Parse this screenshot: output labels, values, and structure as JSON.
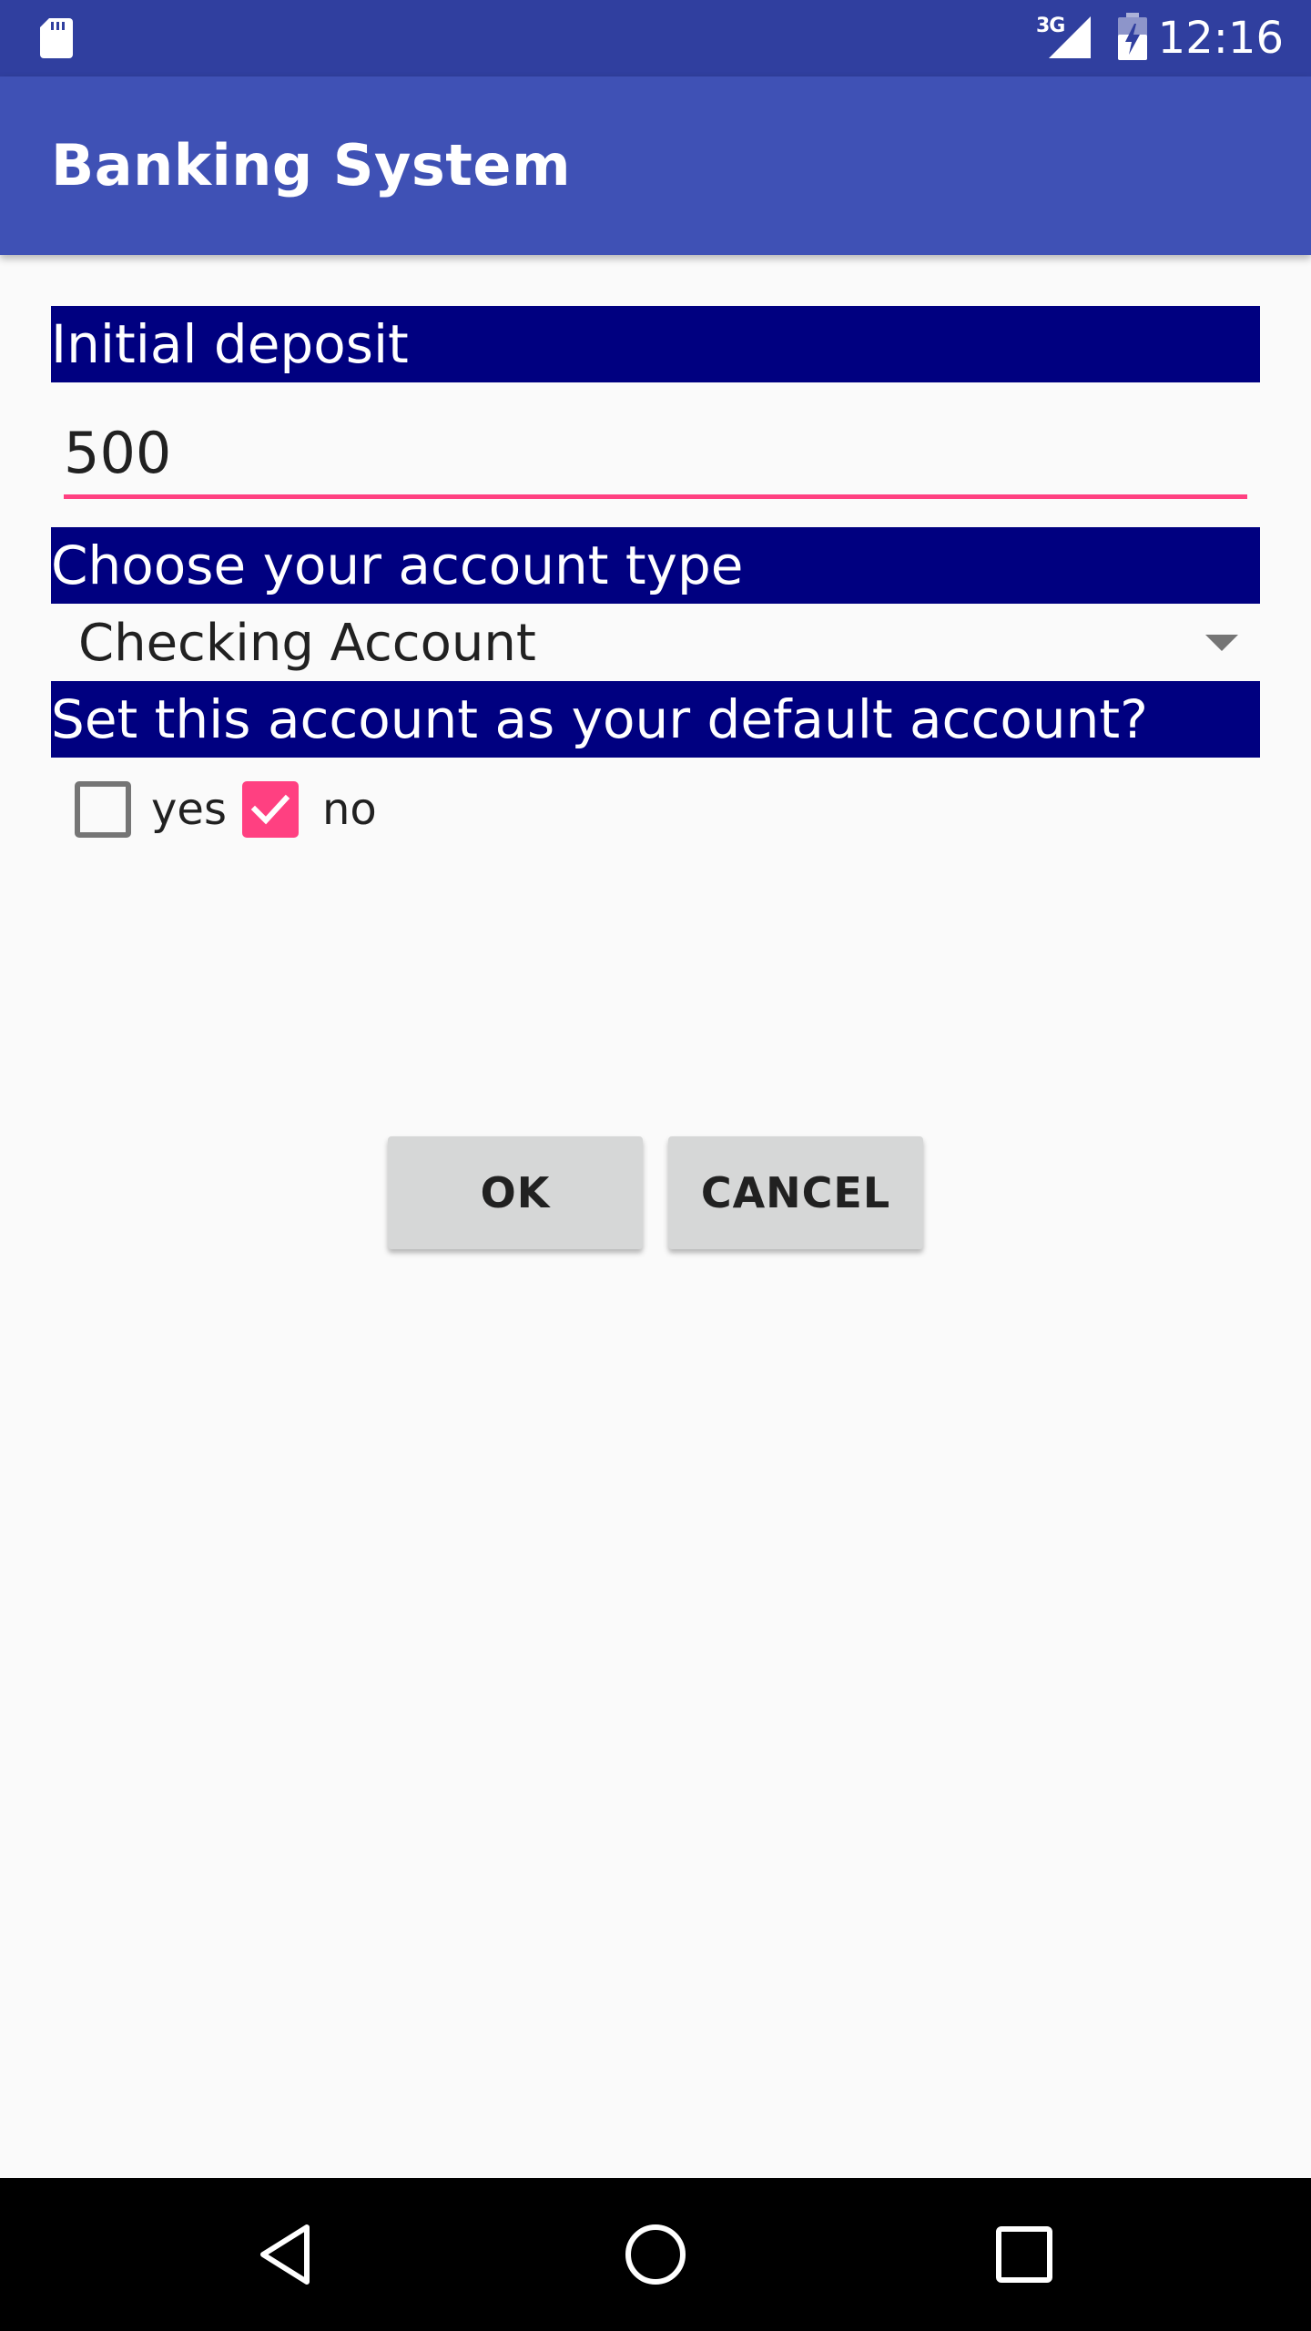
{
  "status_bar": {
    "time": "12:16",
    "network": "3G",
    "icons": [
      "sd-card-icon",
      "signal-icon",
      "battery-icon"
    ]
  },
  "app_bar": {
    "title": "Banking System"
  },
  "form": {
    "deposit_label": "Initial deposit",
    "deposit_value": "500",
    "account_type_label": "Choose your account type",
    "account_type_selected": "Checking Account",
    "default_label": "Set this account as your default account?",
    "options": {
      "yes_label": "yes",
      "yes_checked": false,
      "no_label": "no",
      "no_checked": true
    }
  },
  "buttons": {
    "ok_label": "OK",
    "cancel_label": "CANCEL"
  },
  "nav_bar": {
    "icons": [
      "back-icon",
      "home-icon",
      "recents-icon"
    ]
  },
  "colors": {
    "status_bar": "#303f9f",
    "app_bar": "#3f51b5",
    "section_header": "#000080",
    "accent": "#ff4081",
    "button": "#d6d7d7",
    "background": "#fafafa"
  }
}
